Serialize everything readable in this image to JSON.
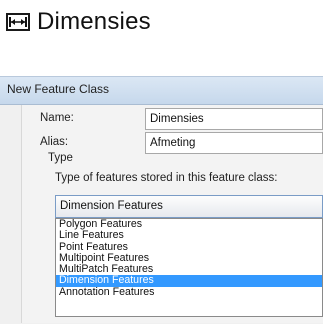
{
  "heading": {
    "title": "Dimensies",
    "icon": "dimension-icon"
  },
  "dialog": {
    "title": "New Feature Class",
    "name_label": "Name:",
    "name_value": "Dimensies",
    "alias_label": "Alias:",
    "alias_value": "Afmeting",
    "type_group_label": "Type",
    "type_prompt": "Type of features stored in this feature class:",
    "selected_type": "Dimension Features",
    "options": [
      {
        "label": "Polygon Features",
        "selected": false
      },
      {
        "label": "Line Features",
        "selected": false
      },
      {
        "label": "Point Features",
        "selected": false
      },
      {
        "label": "Multipoint Features",
        "selected": false
      },
      {
        "label": "MultiPatch Features",
        "selected": false
      },
      {
        "label": "Dimension Features",
        "selected": true
      },
      {
        "label": "Annotation Features",
        "selected": false
      }
    ]
  }
}
